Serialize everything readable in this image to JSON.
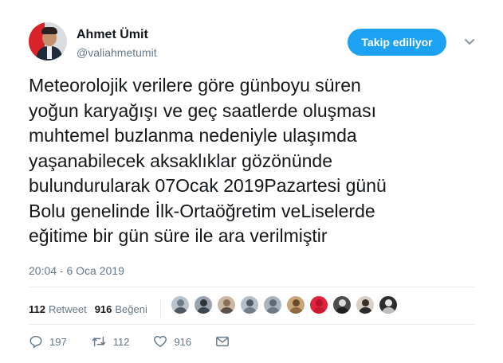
{
  "author": {
    "name": "Ahmet Ümit",
    "handle": "@valiahmetumit"
  },
  "follow_button_label": "Takip ediliyor",
  "tweet": {
    "lines": [
      "Meteorolojik verilere göre günboyu süren",
      "yoğun karyağışı ve geç saatlerde oluşması",
      "muhtemel buzlanma nedeniyle ulaşımda",
      "yaşanabilecek aksaklıklar gözönünde",
      "bulundurularak 07Ocak 2019Pazartesi günü",
      "Bolu genelinde İlk-Ortaöğretim veLiselerde",
      "eğitime bir gün süre ile ara verilmiştir"
    ],
    "timestamp": "20:04 - 6 Oca 2019"
  },
  "stats": {
    "retweet_count": "112",
    "retweet_label": "Retweet",
    "like_count": "916",
    "like_label": "Beğeni"
  },
  "likers": [
    {
      "icon": "avatar-liker-1",
      "bg": "#b9c3cc",
      "head": "#6f7b86",
      "body": "#4e5964"
    },
    {
      "icon": "avatar-liker-2",
      "bg": "#9aa3ab",
      "head": "#2f3438",
      "body": "#3b4650"
    },
    {
      "icon": "avatar-liker-3",
      "bg": "#c9b9a2",
      "head": "#8b6e57",
      "body": "#5a5048"
    },
    {
      "icon": "avatar-liker-4",
      "bg": "#b5bec7",
      "head": "#4f5a66",
      "body": "#707c88"
    },
    {
      "icon": "avatar-liker-5",
      "bg": "#aab4bd",
      "head": "#5e6a75",
      "body": "#6e7a85"
    },
    {
      "icon": "avatar-liker-6",
      "bg": "#c7a77a",
      "head": "#6b4a2a",
      "body": "#8f6a3e"
    },
    {
      "icon": "avatar-liker-7",
      "bg": "#e0243b",
      "head": "#b81228",
      "body": "#c81a30"
    },
    {
      "icon": "avatar-liker-8",
      "bg": "#4c4c4c",
      "head": "#dcdcdc",
      "body": "#1f1f1f"
    },
    {
      "icon": "avatar-liker-9",
      "bg": "#d8d0c6",
      "head": "#3a2f29",
      "body": "#2a2a2a"
    },
    {
      "icon": "avatar-liker-10",
      "bg": "#2d2d2d",
      "head": "#e7e7e7",
      "body": "#bfbfbf"
    }
  ],
  "actions": {
    "reply_count": "197",
    "retweet_count": "112",
    "like_count": "916"
  },
  "colors": {
    "accent": "#1da1f2",
    "text": "#14171a",
    "muted": "#657786",
    "divider": "#e6ecf0"
  }
}
